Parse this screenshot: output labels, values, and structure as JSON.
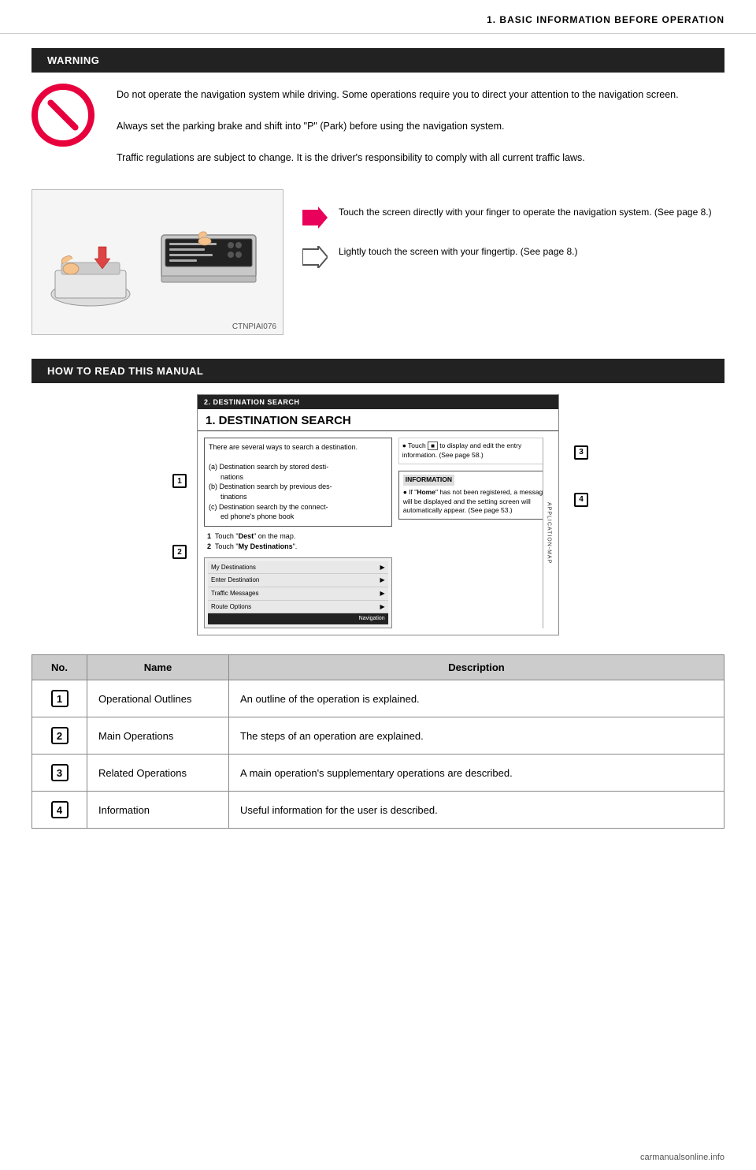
{
  "header": {
    "title": "1. BASIC INFORMATION BEFORE OPERATION"
  },
  "section1": {
    "bar_label": "WARNING",
    "no_icon_alt": "No/prohibited icon",
    "text_lines": [
      "Do not operate the navigation system while driving. Some operations require you to direct your attention to the navigation screen.",
      "Always set the parking brake and shift into \"P\" (Park) before using the navigation system.",
      "Traffic regulations are subject to change. It is the driver's responsibility to comply with all current traffic laws."
    ]
  },
  "arrows": {
    "filled_arrow": {
      "alt": "filled pink right arrow",
      "text": "Touch the screen directly with your finger to operate the navigation system. (See page 8.)"
    },
    "outline_arrow": {
      "alt": "outline right arrow",
      "text": "Lightly touch the screen with your fingertip. (See page 8.)"
    }
  },
  "car_image_label": "CTNPIAI076",
  "section2": {
    "bar_label": "HOW TO READ THIS MANUAL",
    "manual_page": {
      "header": "2. DESTINATION SEARCH",
      "title": "1. DESTINATION SEARCH",
      "left_box_text": [
        "There are several ways to search a destination.",
        "(a) Destination search by stored destinations",
        "(b) Destination search by previous destinations",
        "(c) Destination search by the connected phone's phone book"
      ],
      "steps": [
        "1  Touch \"Dest\" on the map.",
        "2  Touch \"My Destinations\"."
      ],
      "right_touch_text": "• Touch        to display and edit the entry information. (See page 58.)",
      "info_header": "INFORMATION",
      "info_text": "● If \"Home\" has not been registered, a message will be displayed and the setting screen will automatically appear. (See page 53.)",
      "nav_items": [
        "My Destinations",
        "Enter Destination",
        "Traffic Messages",
        "Route Options"
      ],
      "nav_footer": "Navigation",
      "app_map_label": "APPLICATION-MAP",
      "callouts": [
        "1",
        "2",
        "3",
        "4"
      ]
    }
  },
  "table": {
    "columns": [
      "No.",
      "Name",
      "Description"
    ],
    "rows": [
      {
        "no": "1",
        "name": "Operational Outlines",
        "description": "An outline of the operation is explained."
      },
      {
        "no": "2",
        "name": "Main Operations",
        "description": "The steps of an operation are explained."
      },
      {
        "no": "3",
        "name": "Related Operations",
        "description": "A main operation's supplementary operations are described."
      },
      {
        "no": "4",
        "name": "Information",
        "description": "Useful information for the user is described."
      }
    ]
  },
  "footer": {
    "url": "carmanualsonline.info"
  }
}
